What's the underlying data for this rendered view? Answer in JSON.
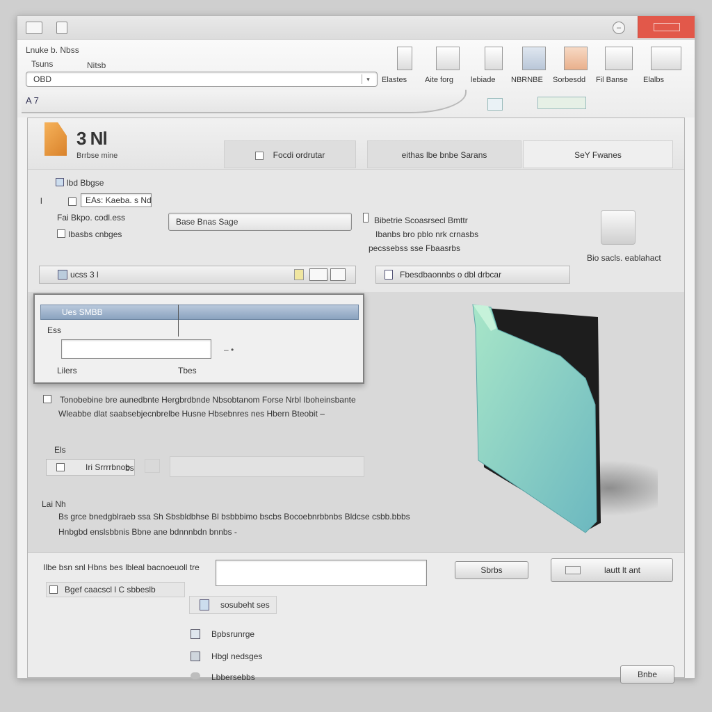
{
  "titlebar": {
    "minimize_glyph": "–"
  },
  "ribbon": {
    "label_1": "Lnuke b. Nbss",
    "label_2": "Tsuns",
    "label_3": "Nitsb",
    "address_value": "OBD",
    "address_dropdown": "▾",
    "tools": [
      {
        "label": "Elastes",
        "icon": "document-icon"
      },
      {
        "label": "Aite forg",
        "icon": "monitor-icon"
      },
      {
        "label": "lebiade",
        "icon": "page-icon"
      },
      {
        "label": "NBRNBE",
        "icon": "list-icon"
      },
      {
        "label": "Sorbesdd",
        "icon": "report-icon"
      },
      {
        "label": "Fil Banse",
        "icon": "table-icon"
      },
      {
        "label": "Elalbs",
        "icon": "window-icon"
      }
    ],
    "tab_code": "A 7"
  },
  "panel": {
    "title": "3 Nl",
    "subtitle": "Brrbse mine",
    "tabs": [
      {
        "label": "Focdi ordrutar"
      },
      {
        "label": "eithas lbe bnbe Sarans"
      },
      {
        "label": "SeY Fwanes"
      }
    ],
    "left": {
      "row_label": "lbd Bbgse",
      "field_prefix": "l",
      "field_value": "EAs: Kaeba. s Nd",
      "field_2": "Fai Bkpo. codl.ess",
      "field_3": "Ibasbs cnbges",
      "search_value": "Base Bnas Sage",
      "bar_label": "ucss 3 l"
    },
    "right": {
      "desc_1": "Bibetrie Scoasrsecl Bmttr",
      "desc_2": "Ibanbs bro pblo nrk crnasbs",
      "desc_3": "pecssebss sse Fbaasrbs",
      "bar_label": "Fbesdbaonnbs o dbl drbcar",
      "side_caption": "Bio sacls. eablahact"
    },
    "dialog": {
      "title": "Ues SMBB",
      "label_1": "Ess",
      "input_value": "",
      "dash": "– •",
      "caption_left": "Lilers",
      "caption_right": "Tbes"
    },
    "notes": {
      "line_1": "Tonobebine bre aunedbnte Hergbrdbnde Nbsobtanom Forse Nrbl Iboheinsbante",
      "line_2": "Wleabbe dlat saabsebjecnbrelbe Husne Hbsebnres nes Hbern Bteobit –",
      "small_label": "Els",
      "checkbox_label": "Iri Srrrrbnob",
      "checkbox_suffix": "bs",
      "section_label": "Lai Nh",
      "para_1": "Bs grce bnedgblraeb ssa Sh Sbsbldbhse Bl bsbbbimo bscbs Bocoebnrbbnbs Bldcse csbb.bbbs",
      "para_2": "Hnbgbd enslsbbnis Bbne ane bdnnnbdn bnnbs -"
    },
    "footer": {
      "label": "Ilbe bsn snl Hbns bes lbleal bacnoeuoll tre",
      "input_value": "",
      "button_small": "Sbrbs",
      "button_large": "lautt lt ant",
      "checkbox_label": "Bgef caacscl l C sbbeslb",
      "sub_item": "sosubeht ses",
      "list": [
        {
          "label": "Bpbsrunrge",
          "icon": "document-icon"
        },
        {
          "label": "Hbgl nedsges",
          "icon": "grid-icon"
        },
        {
          "label": "Lbbersebbs",
          "icon": "link-icon"
        }
      ],
      "bottom_button": "Bnbe"
    }
  },
  "colors": {
    "close_button": "#e2584a",
    "accent_blue": "#8aa2bf",
    "folder_teal": "#7ec8c0",
    "folder_light": "#a8e6c8",
    "orange_doc": "#e8983c"
  }
}
